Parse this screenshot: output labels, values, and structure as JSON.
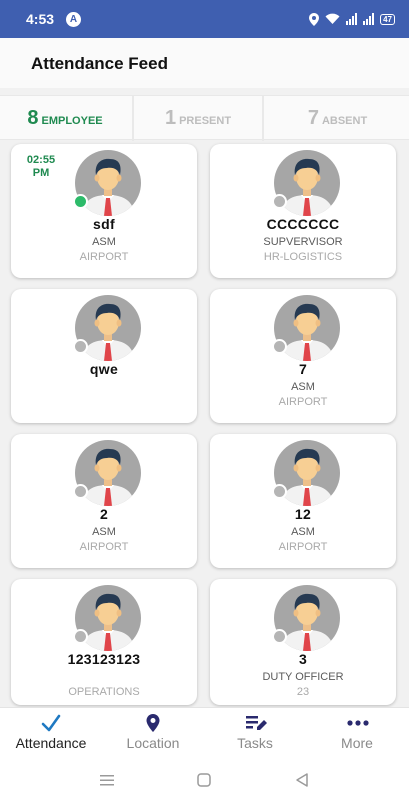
{
  "status_bar": {
    "time": "4:53",
    "notif_icon": "A",
    "battery": "47"
  },
  "header": {
    "title": "Attendance Feed"
  },
  "tabs": [
    {
      "count": "8",
      "label": "EMPLOYEE",
      "active": true
    },
    {
      "count": "1",
      "label": "PRESENT",
      "active": false
    },
    {
      "count": "7",
      "label": "ABSENT",
      "active": false
    }
  ],
  "employees": [
    {
      "time": "02:55 PM",
      "name": "sdf",
      "role": "ASM",
      "dept": "AIRPORT",
      "status": "present"
    },
    {
      "time": "",
      "name": "CCCCCCC",
      "role": "SUPVERVISOR",
      "dept": "HR-LOGISTICS",
      "status": "absent"
    },
    {
      "time": "",
      "name": "qwe",
      "role": "",
      "dept": "",
      "status": "absent"
    },
    {
      "time": "",
      "name": "7",
      "role": "ASM",
      "dept": "AIRPORT",
      "status": "absent"
    },
    {
      "time": "",
      "name": "2",
      "role": "ASM",
      "dept": "AIRPORT",
      "status": "absent"
    },
    {
      "time": "",
      "name": "12",
      "role": "ASM",
      "dept": "AIRPORT",
      "status": "absent"
    },
    {
      "time": "",
      "name": "123123123",
      "role": "",
      "dept": "OPERATIONS",
      "status": "absent"
    },
    {
      "time": "",
      "name": "3",
      "role": "DUTY OFFICER",
      "dept": "23",
      "status": "absent"
    }
  ],
  "bottom_nav": [
    {
      "label": "Attendance",
      "icon": "check-icon",
      "active": true
    },
    {
      "label": "Location",
      "icon": "location-pin-icon",
      "active": false
    },
    {
      "label": "Tasks",
      "icon": "tasks-edit-icon",
      "active": false
    },
    {
      "label": "More",
      "icon": "more-dots-icon",
      "active": false
    }
  ],
  "colors": {
    "status_bar": "#3f5fb0",
    "accent_green": "#1f8a50",
    "online_dot": "#2dbb6a",
    "nav_icon": "#2a2a6e"
  }
}
